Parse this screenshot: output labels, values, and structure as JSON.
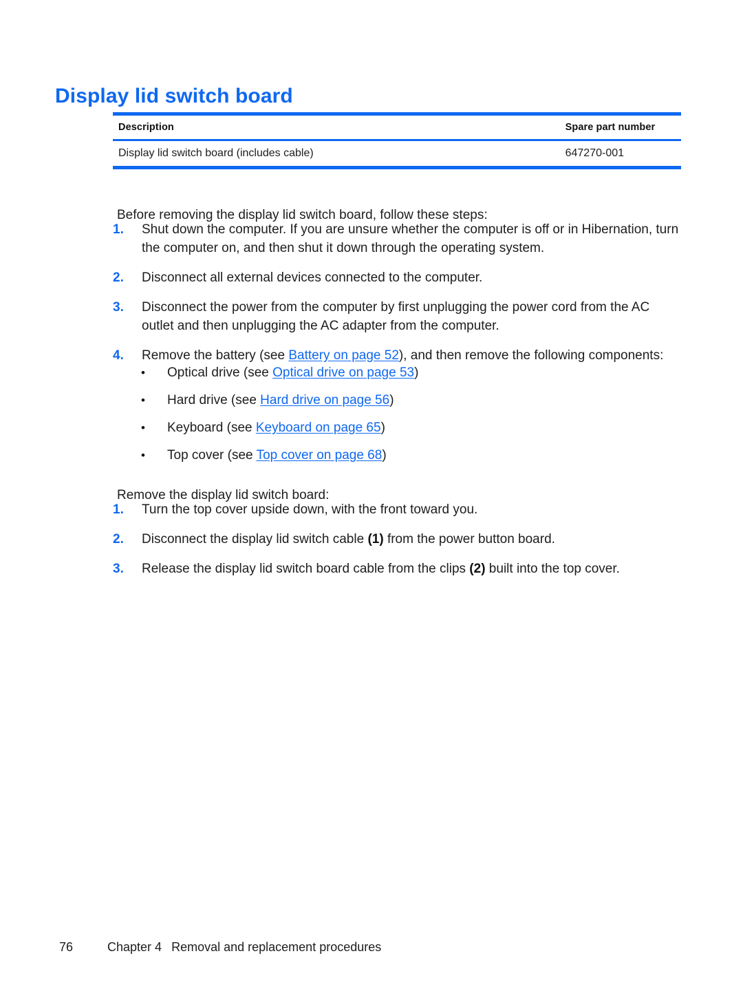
{
  "document": {
    "title": "Display lid switch board"
  },
  "parts_table": {
    "headers": {
      "description": "Description",
      "spare_part_number": "Spare part number"
    },
    "rows": [
      {
        "description": "Display lid switch board (includes cable)",
        "spare_part_number": "647270-001"
      }
    ]
  },
  "intro": {
    "before_steps": "Before removing the display lid switch board, follow these steps:",
    "remove_steps": "Remove the display lid switch board:"
  },
  "preliminary_steps": [
    {
      "number": "1.",
      "text": "Shut down the computer. If you are unsure whether the computer is off or in Hibernation, turn the computer on, and then shut it down through the operating system."
    },
    {
      "number": "2.",
      "text": "Disconnect all external devices connected to the computer."
    },
    {
      "number": "3.",
      "text": "Disconnect the power from the computer by first unplugging the power cord from the AC outlet and then unplugging the AC adapter from the computer."
    },
    {
      "number": "4.",
      "text_before_link": "Remove the battery (see ",
      "link": "Battery on page 52",
      "text_after_link": "), and then remove the following components:"
    }
  ],
  "components": [
    {
      "bullet": "•",
      "text_before_link": "Optical drive (see ",
      "link": "Optical drive on page 53",
      "text_after_link": ")"
    },
    {
      "bullet": "•",
      "text_before_link": "Hard drive (see ",
      "link": "Hard drive on page 56",
      "text_after_link": ")"
    },
    {
      "bullet": "•",
      "text_before_link": "Keyboard (see ",
      "link": "Keyboard on page 65",
      "text_after_link": ")"
    },
    {
      "bullet": "•",
      "text_before_link": "Top cover (see ",
      "link": "Top cover on page 68",
      "text_after_link": ")"
    }
  ],
  "removal_steps": [
    {
      "number": "1.",
      "text": "Turn the top cover upside down, with the front toward you."
    },
    {
      "number": "2.",
      "text_before_callout": "Disconnect the display lid switch cable ",
      "callout": "(1)",
      "text_after_callout": " from the power button board."
    },
    {
      "number": "3.",
      "text_before_callout": "Release the display lid switch board cable from the clips ",
      "callout": "(2)",
      "text_after_callout": " built into the top cover."
    }
  ],
  "footer": {
    "page_number": "76",
    "chapter": "Chapter 4",
    "chapter_title": "Removal and replacement procedures"
  },
  "colors": {
    "accent_blue": "#0f68f0",
    "body_text": "#1d1d1d",
    "page_background": "#ffffff"
  }
}
